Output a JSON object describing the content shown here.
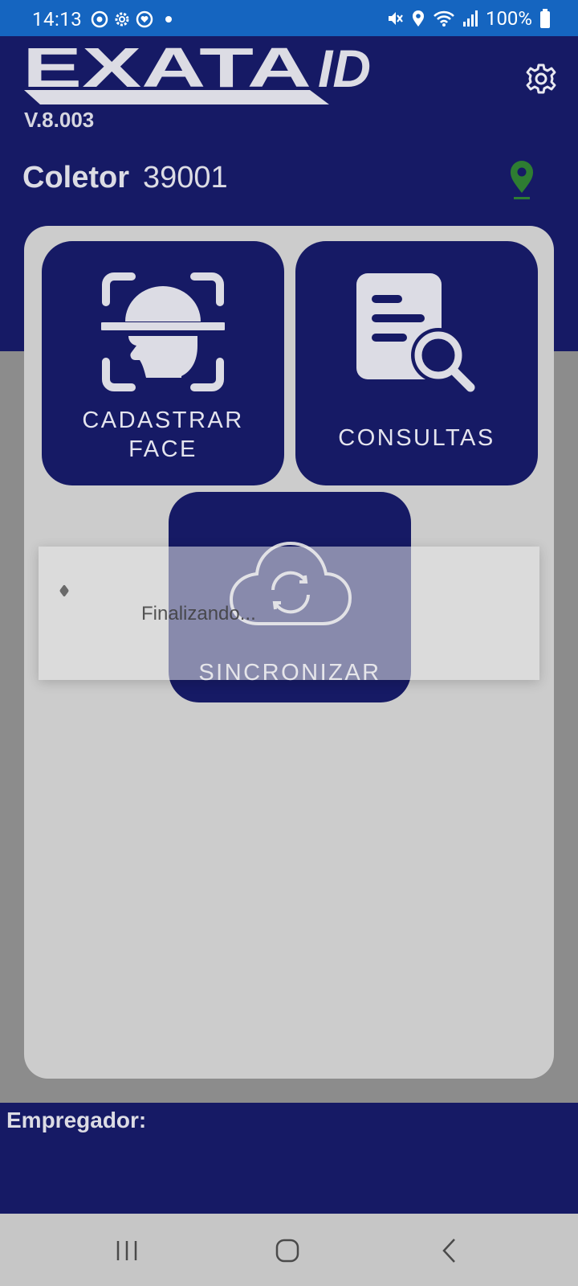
{
  "status_bar": {
    "time": "14:13",
    "battery": "100%",
    "icons": [
      "sync-status-icon",
      "settings-status-icon",
      "heart-status-icon",
      "notification-dot-icon",
      "mute-icon",
      "location-status-icon",
      "wifi-icon",
      "signal-icon",
      "battery-icon"
    ]
  },
  "header": {
    "logo_text": "EXATA",
    "logo_suffix": "ID",
    "version": "V.8.003",
    "collector_label": "Coletor",
    "collector_value": "39001",
    "settings_icon": "gear-icon",
    "location_icon": "location-pin-icon"
  },
  "tiles": {
    "face": {
      "line1": "CADASTRAR",
      "line2": "FACE",
      "icon": "face-scan-icon"
    },
    "consult": {
      "label": "CONSULTAS",
      "icon": "document-search-icon"
    },
    "sync": {
      "label": "SINCRONIZAR",
      "icon": "cloud-sync-icon"
    }
  },
  "dialog": {
    "message": "Finalizando..."
  },
  "footer": {
    "employer_label": "Empregador:"
  },
  "nav": {
    "recents_icon": "recents-icon",
    "home_icon": "home-icon",
    "back_icon": "back-icon"
  },
  "colors": {
    "primary": "#161a65",
    "status_bar": "#1565c0",
    "panel": "#cccccc",
    "pin": "#2e7d32"
  }
}
